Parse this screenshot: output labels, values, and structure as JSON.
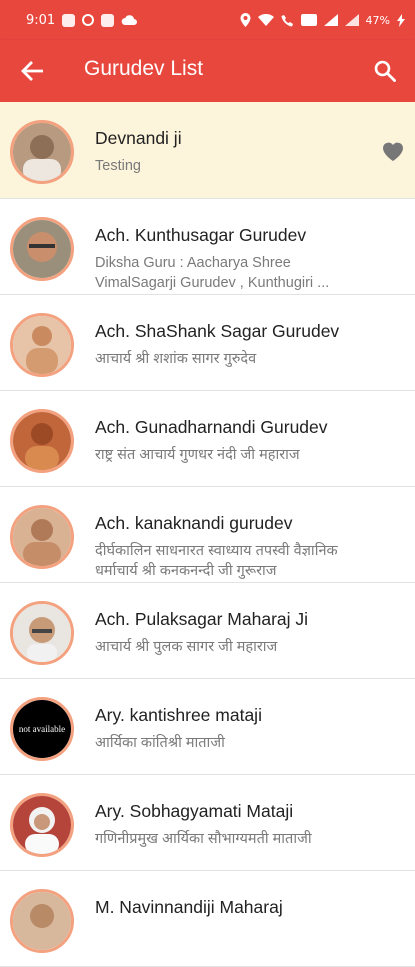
{
  "status_bar": {
    "time": "9:01",
    "battery": "47%"
  },
  "app_bar": {
    "title": "Gurudev List",
    "back_icon": "arrow-back-icon",
    "search_icon": "search-icon"
  },
  "colors": {
    "primary": "#e8473e",
    "highlight_row": "#fdf4dc",
    "avatar_border": "#f3a17f"
  },
  "gurus": [
    {
      "name": "Devnandi ji",
      "subtitle": "Testing",
      "favorite": true,
      "avatar": "photo"
    },
    {
      "name": "Ach.  Kunthusagar Gurudev",
      "subtitle": "Diksha Guru : Aacharya Shree VimalSagarji Gurudev , Kunthugiri ...",
      "avatar": "photo"
    },
    {
      "name": "Ach.  ShaShank Sagar Gurudev",
      "subtitle": "आचार्य श्री शशांक सागर गुरुदेव",
      "avatar": "photo"
    },
    {
      "name": "Ach. Gunadharnandi Gurudev",
      "subtitle": "राष्ट्र संत आचार्य गुणधर नंदी जी महाराज",
      "avatar": "photo"
    },
    {
      "name": "Ach. kanaknandi gurudev",
      "subtitle": "दीर्घकालिन साधनारत स्वाध्याय तपस्वी वैज्ञानिक धर्माचार्य श्री कनकनन्दी जी गुरूराज",
      "avatar": "photo"
    },
    {
      "name": "Ach. Pulaksagar Maharaj Ji",
      "subtitle": "आचार्य श्री पुलक सागर जी महाराज",
      "avatar": "photo"
    },
    {
      "name": "Ary. kantishree  mataji",
      "subtitle": "आर्यिका कांतिश्री माताजी",
      "avatar": "not-available",
      "avatar_text": "not available"
    },
    {
      "name": "Ary. Sobhagyamati Mataji",
      "subtitle": "गणिनीप्रमुख आर्यिका सौभाग्यमती माताजी",
      "avatar": "photo"
    },
    {
      "name": "M. Navinnandiji Maharaj",
      "subtitle": "",
      "avatar": "photo"
    }
  ]
}
